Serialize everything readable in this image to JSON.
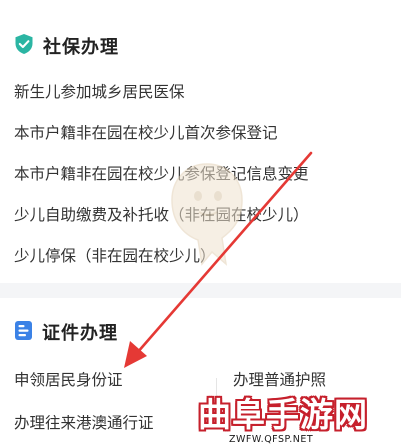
{
  "social_security": {
    "title": "社保办理",
    "icon": "shield-check-icon",
    "icon_color": "#2bb5a3",
    "items": [
      {
        "label": "新生儿参加城乡居民医保"
      },
      {
        "label": "本市户籍非在园在校少儿首次参保登记"
      },
      {
        "label": "本市户籍非在园在校少儿参保登记信息变更"
      },
      {
        "label": "少儿自助缴费及补托收（非在园在校少儿）"
      },
      {
        "label": "少儿停保（非在园在校少儿）"
      }
    ]
  },
  "certificates": {
    "title": "证件办理",
    "icon": "id-card-icon",
    "icon_color": "#3b82e6",
    "items": [
      {
        "label": "申领居民身份证"
      },
      {
        "label": "办理普通护照"
      },
      {
        "label": "办理往来港澳通行证"
      }
    ]
  },
  "annotation": {
    "type": "red-arrow",
    "color": "#e53935",
    "target": "申领居民身份证"
  },
  "watermark": {
    "brand": "曲阜手游网",
    "url": "ZWFW.QFSP.NET",
    "brand_color": "#c6202c"
  }
}
